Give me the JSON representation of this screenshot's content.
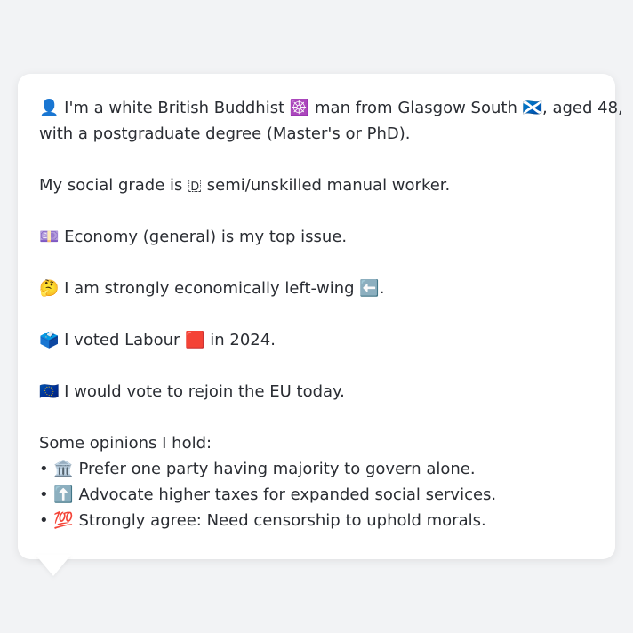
{
  "bubble": {
    "intro": {
      "line1": "👤 I'm a white British Buddhist ☸️ man from Glasgow South 🏴󠁧󠁢󠁳󠁣󠁴󠁿, aged 48,",
      "line2": "with a postgraduate degree (Master's or PhD)."
    },
    "social_grade": "My social grade is 🇩 semi/unskilled manual worker.",
    "top_issue": "💷 Economy (general) is my top issue.",
    "economic_position": "🤔 I am strongly economically left-wing ⬅️.",
    "vote_2024": "🗳️ I voted Labour 🟥 in 2024.",
    "eu": "🇪🇺 I would vote to rejoin the EU today.",
    "opinions": {
      "heading": "Some opinions I hold:",
      "items": [
        "• 🏛️ Prefer one party having majority to govern alone.",
        "• ⬆️ Advocate higher taxes for expanded social services.",
        "• 💯 Strongly agree: Need censorship to uphold morals."
      ]
    }
  }
}
